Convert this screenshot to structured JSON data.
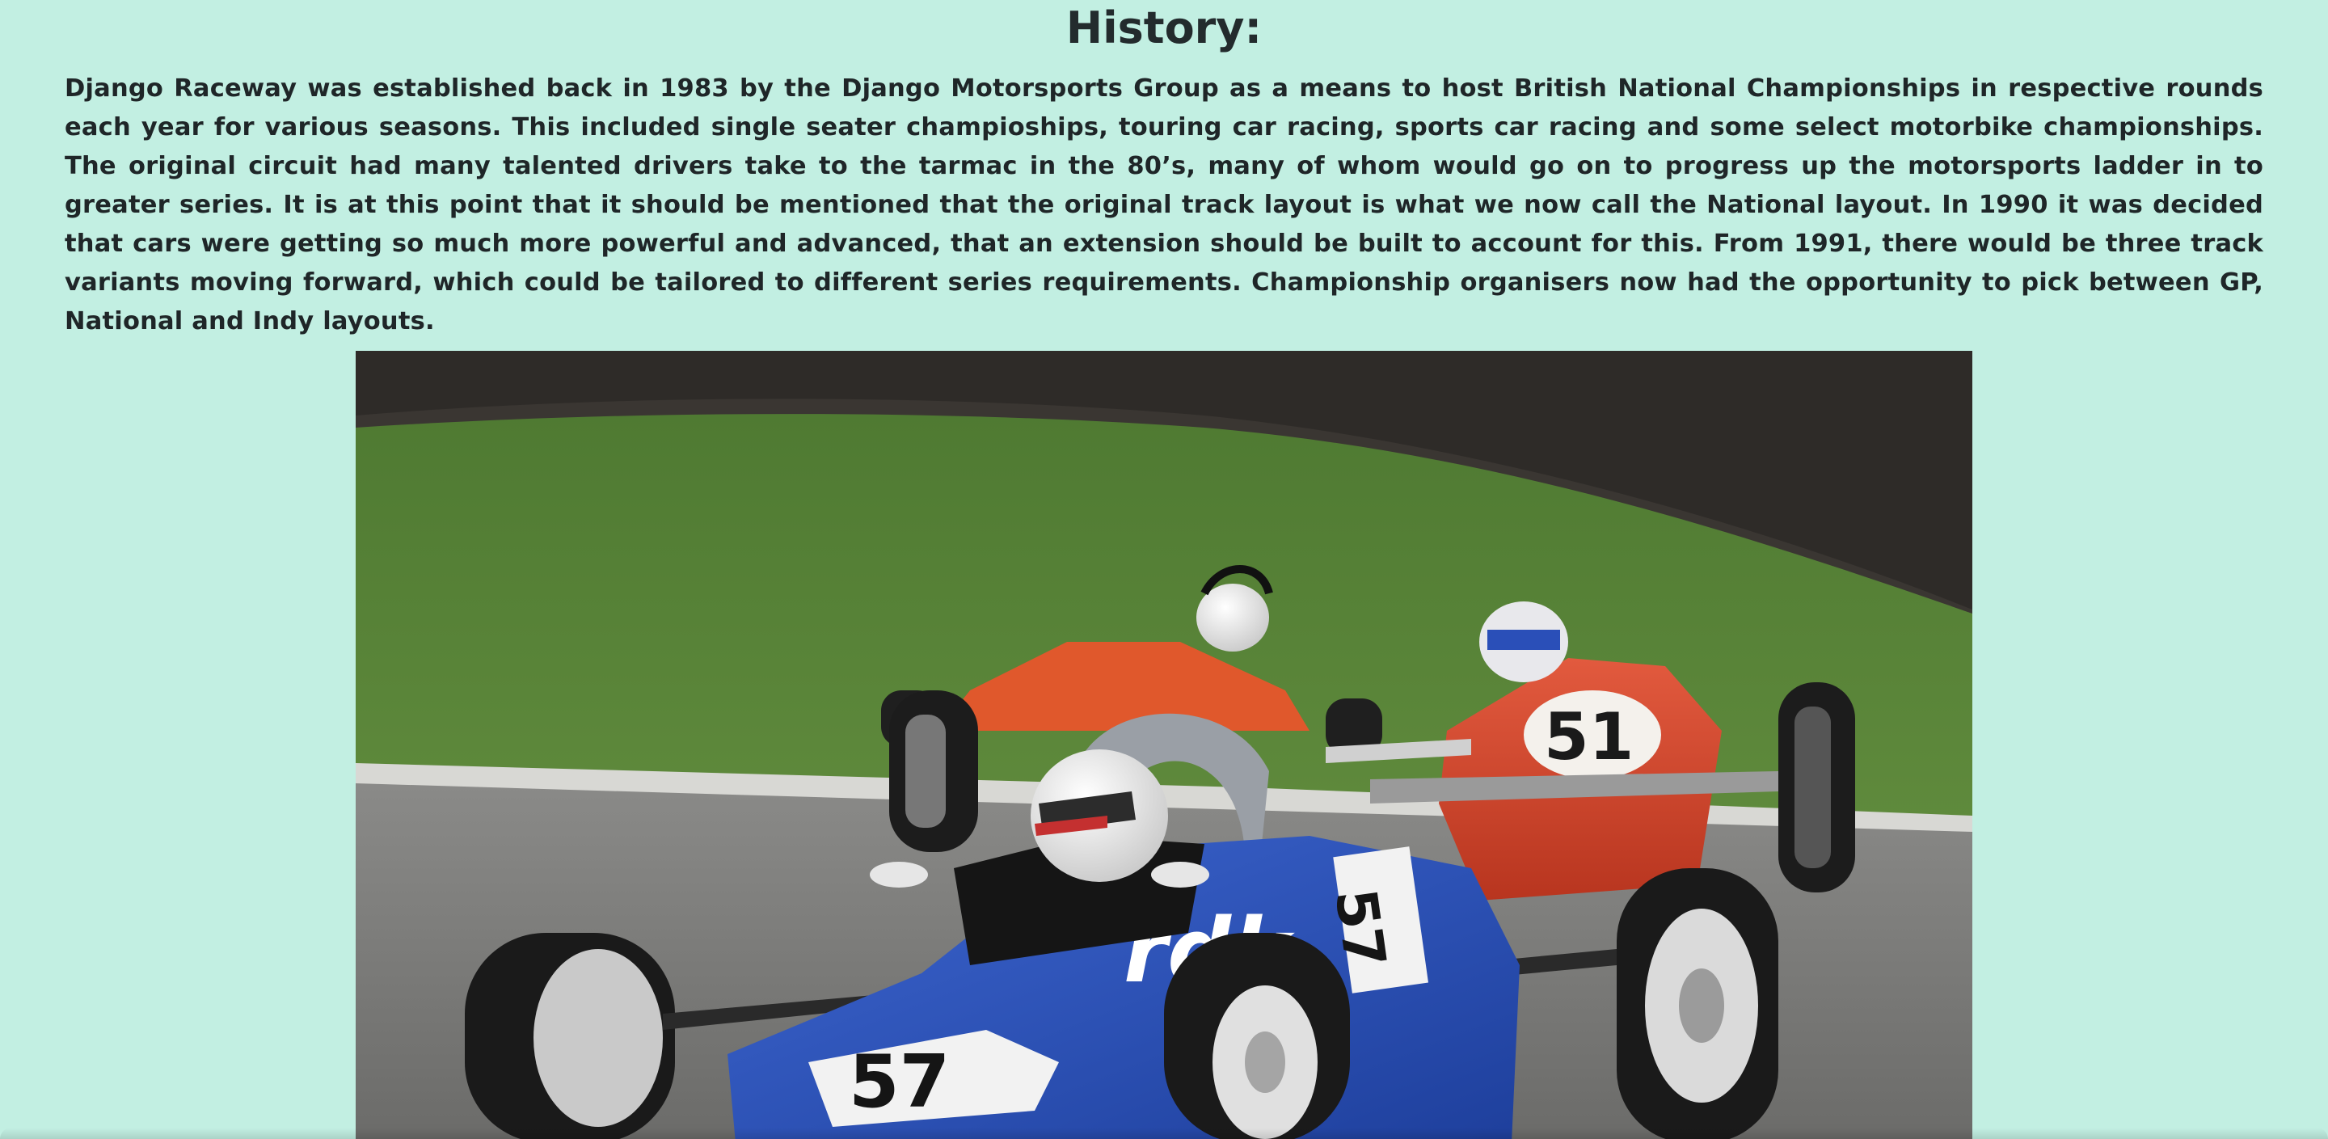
{
  "history": {
    "title": "History:",
    "paragraph": "Django Raceway was established back in 1983 by the Django Motorsports Group as a means to host British National Championships in respective rounds each year for various seasons. This included single seater champioships, touring car racing, sports car racing and some select motorbike championships. The original circuit had many talented drivers take to the tarmac in the 80’s, many of whom would go on to progress up the motorsports ladder in to greater series. It is at this point that it should be mentioned that the original track layout is what we now call the National layout. In 1990 it was decided that cars were getting so much more powerful and advanced, that an extension should be built to account for this. From 1991, there would be three track variants moving forward, which could be tailored to different series requirements. Championship organisers now had the opportunity to pick between GP, National and Indy layouts."
  },
  "photo": {
    "subject": "formula-ford-race-cars",
    "lead_car_number": "57",
    "second_car_number": "51",
    "lead_car_color": "#2a4fb8",
    "second_car_color": "#d2452e",
    "third_car_color": "#e0582c"
  },
  "colors": {
    "background": "#c2efe2",
    "text": "#1f2628"
  }
}
